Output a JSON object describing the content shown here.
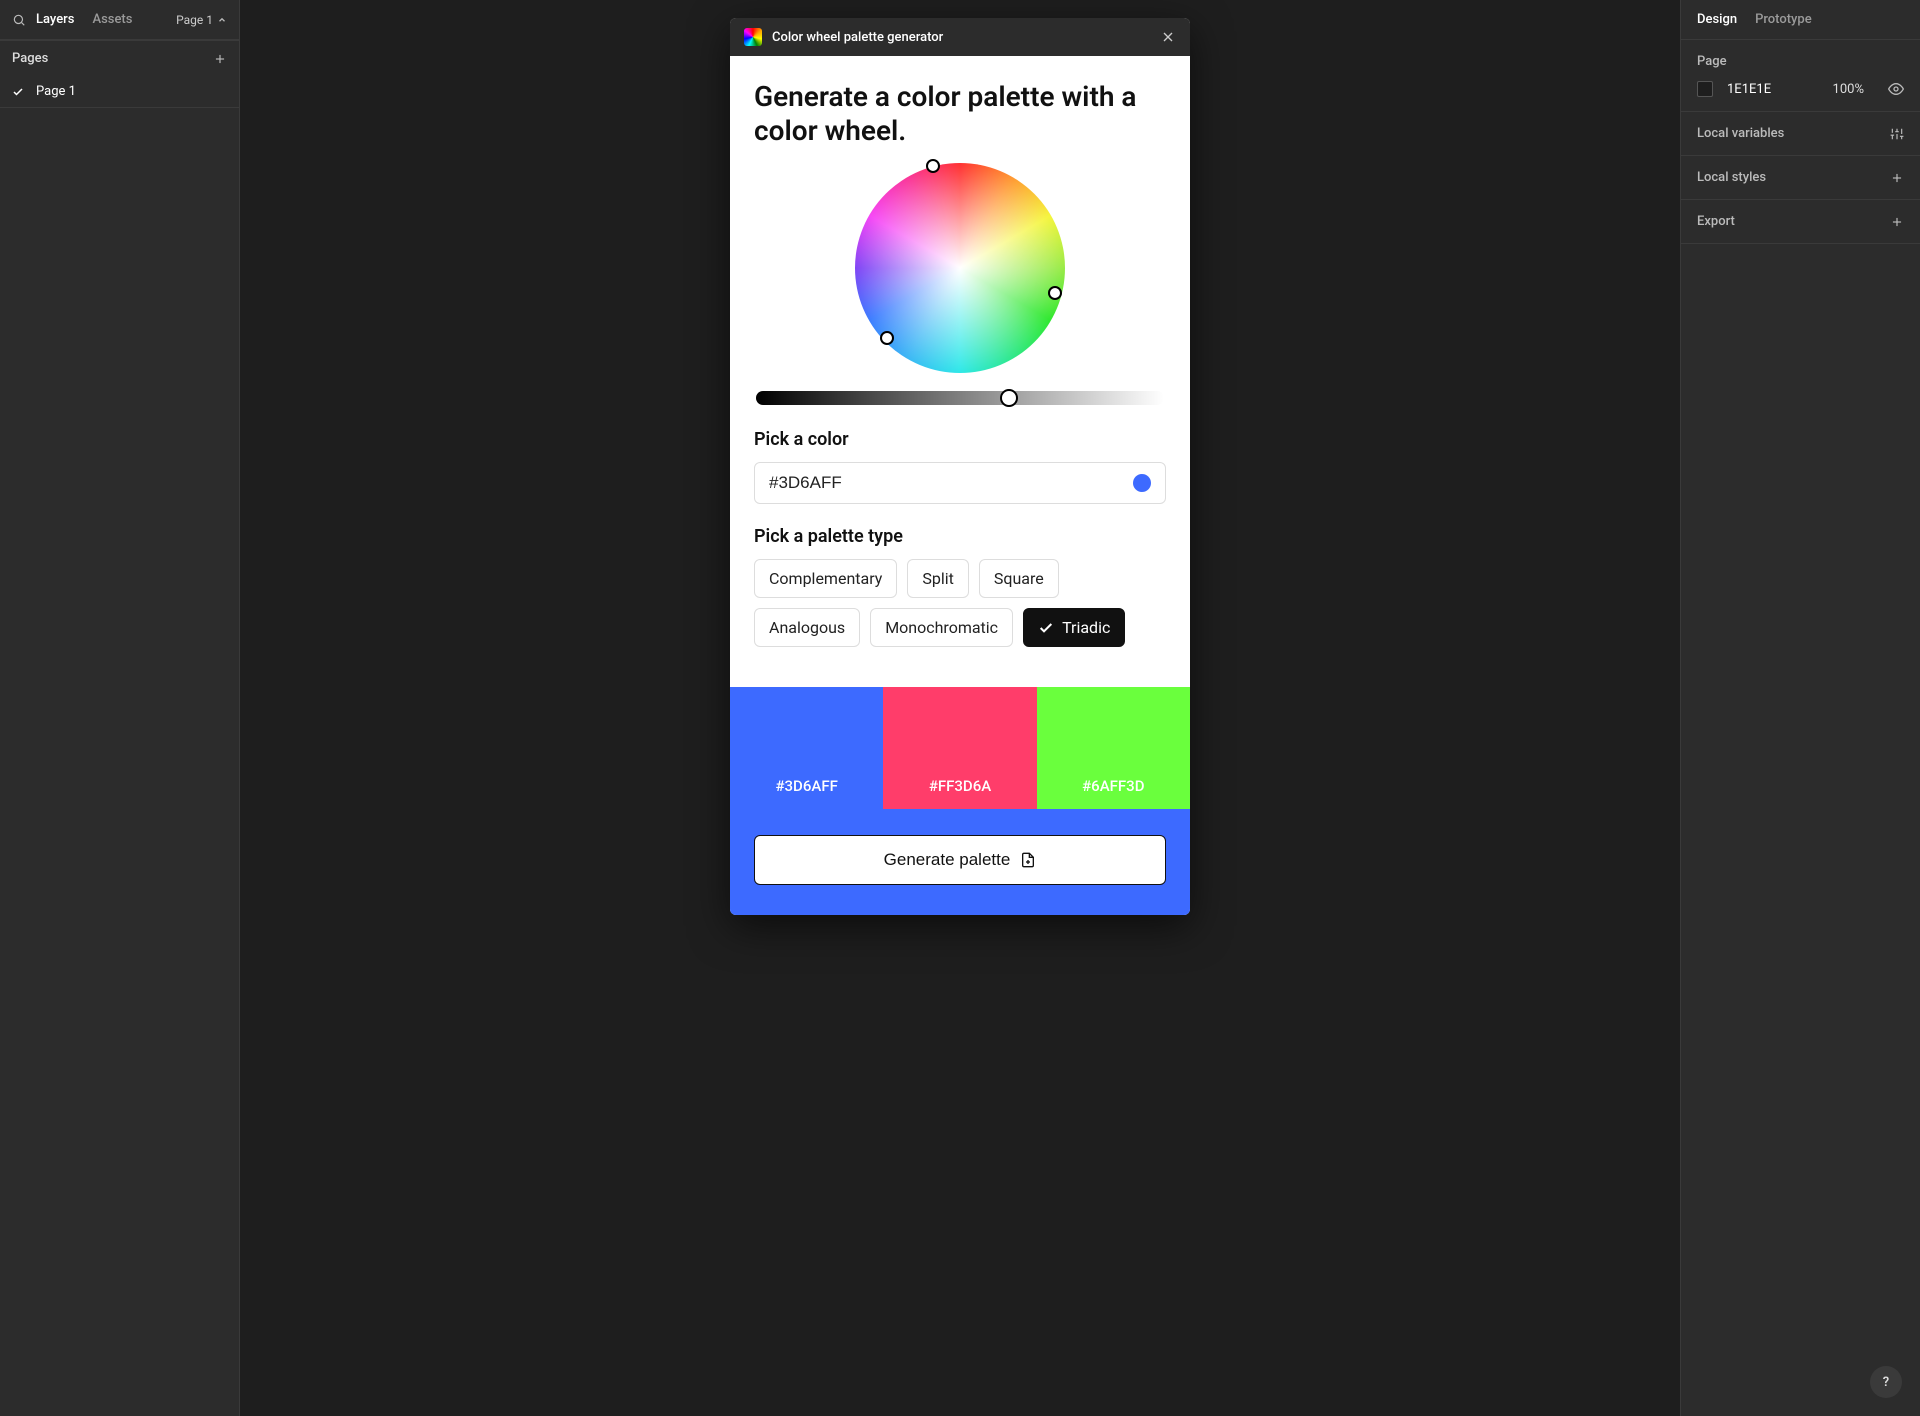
{
  "left_panel": {
    "tabs": {
      "layers": "Layers",
      "assets": "Assets"
    },
    "page_selector": "Page 1",
    "section_header": "Pages",
    "pages": [
      {
        "name": "Page 1",
        "selected": true
      }
    ]
  },
  "plugin": {
    "title": "Color wheel palette generator",
    "heading": "Generate a color palette with a color wheel.",
    "pick_color_label": "Pick a color",
    "color_value": "#3D6AFF",
    "color_preview": "#3D6AFF",
    "pick_palette_label": "Pick a palette type",
    "palette_types": [
      {
        "label": "Complementary",
        "selected": false
      },
      {
        "label": "Split",
        "selected": false
      },
      {
        "label": "Square",
        "selected": false
      },
      {
        "label": "Analogous",
        "selected": false
      },
      {
        "label": "Monochromatic",
        "selected": false
      },
      {
        "label": "Triadic",
        "selected": true
      }
    ],
    "swatches": [
      {
        "hex": "#3D6AFF",
        "bg": "#3D6AFF"
      },
      {
        "hex": "#FF3D6A",
        "bg": "#FF3D6A"
      },
      {
        "hex": "#6AFF3D",
        "bg": "#6AFF3D"
      }
    ],
    "generate_label": "Generate palette"
  },
  "right_panel": {
    "tabs": {
      "design": "Design",
      "prototype": "Prototype"
    },
    "page": {
      "label": "Page",
      "bg_hex": "1E1E1E",
      "opacity": "100%"
    },
    "sections": {
      "local_variables": "Local variables",
      "local_styles": "Local styles",
      "export": "Export"
    }
  },
  "help_label": "?"
}
